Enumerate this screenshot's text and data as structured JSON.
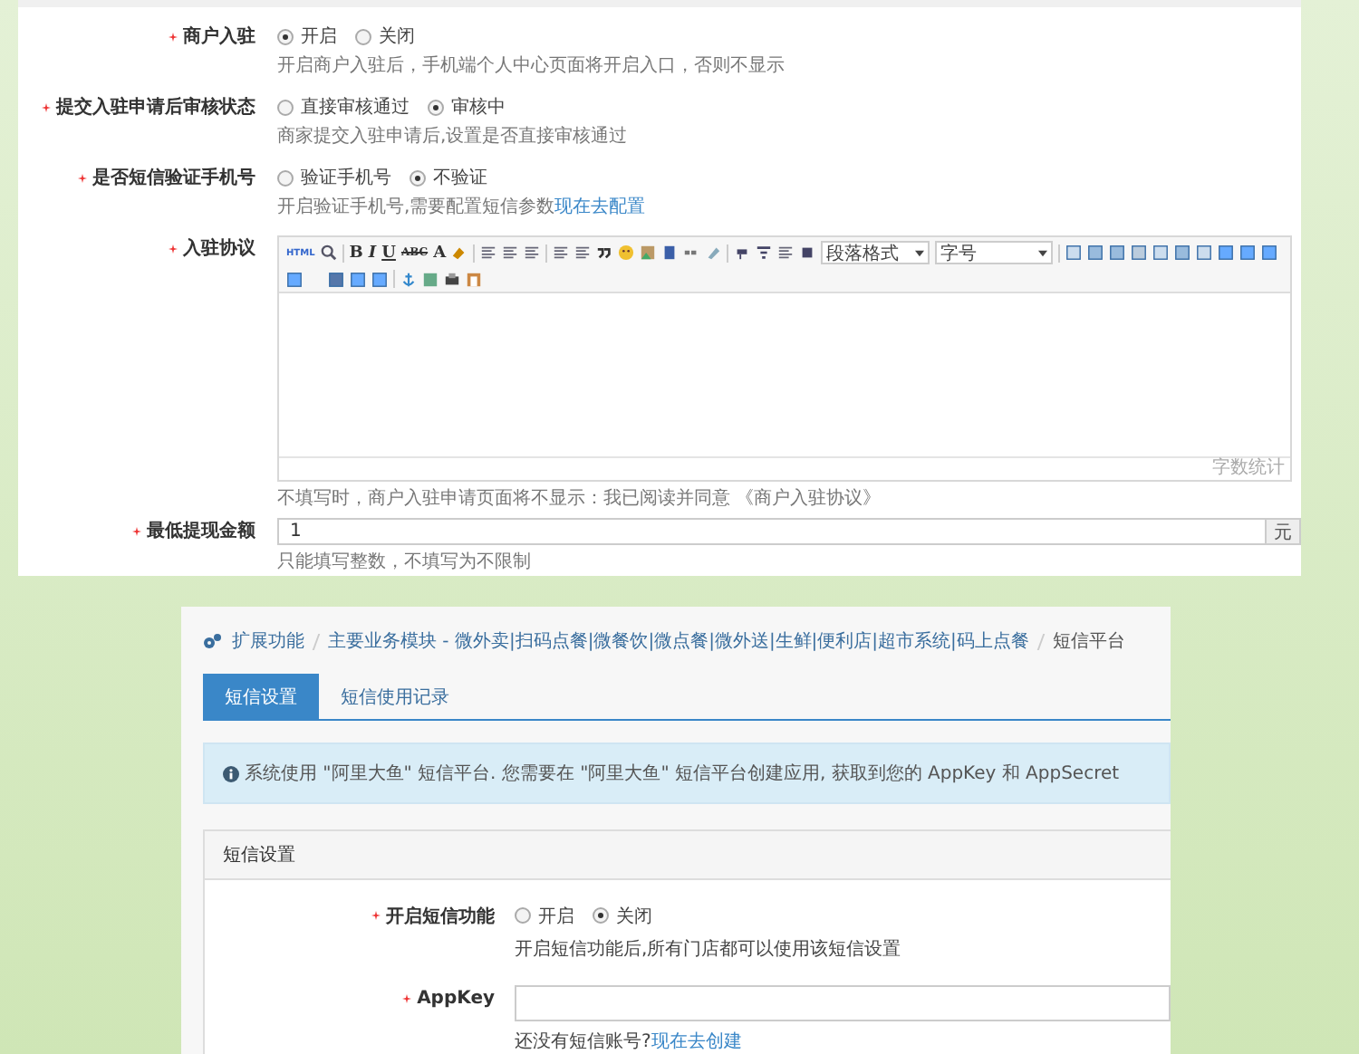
{
  "top_form": {
    "rows": [
      {
        "kind": "radio",
        "label": "商户入驻",
        "required": true,
        "options": [
          {
            "label": "开启",
            "selected": true
          },
          {
            "label": "关闭",
            "selected": false
          }
        ],
        "hint": "开启商户入驻后，手机端个人中心页面将开启入口，否则不显示"
      },
      {
        "kind": "radio",
        "label": "提交入驻申请后审核状态",
        "required": true,
        "options": [
          {
            "label": "直接审核通过",
            "selected": false
          },
          {
            "label": "审核中",
            "selected": true
          }
        ],
        "hint": "商家提交入驻申请后,设置是否直接审核通过"
      },
      {
        "kind": "radio",
        "label": "是否短信验证手机号",
        "required": true,
        "options": [
          {
            "label": "验证手机号",
            "selected": false
          },
          {
            "label": "不验证",
            "selected": true
          }
        ],
        "hint": "开启验证手机号,需要配置短信参数",
        "hint_link": "现在去配置"
      },
      {
        "kind": "editor",
        "label": "入驻协议",
        "required": true,
        "toolbar": {
          "html_label": "HTML",
          "text_buttons": [
            "B",
            "I",
            "U",
            "ABC",
            "A"
          ],
          "selects": [
            "段落格式",
            "字号"
          ]
        },
        "word_count": "字数统计",
        "hint": "不填写时，商户入驻申请页面将不显示：我已阅读并同意 《商户入驻协议》"
      },
      {
        "kind": "input",
        "label": "最低提现金额",
        "required": true,
        "value": "1",
        "addon": "元",
        "hint": "只能填写整数，不填写为不限制"
      }
    ]
  },
  "sms_page": {
    "breadcrumb": [
      {
        "label": "扩展功能",
        "current": false
      },
      {
        "label": "主要业务模块 - 微外卖|扫码点餐|微餐饮|微点餐|微外送|生鲜|便利店|超市系统|码上点餐",
        "current": false
      },
      {
        "label": "短信平台",
        "current": true
      }
    ],
    "tabs": [
      {
        "label": "短信设置",
        "selected": true
      },
      {
        "label": "短信使用记录",
        "selected": false
      }
    ],
    "alert": "系统使用 \"阿里大鱼\" 短信平台. 您需要在 \"阿里大鱼\" 短信平台创建应用, 获取到您的 AppKey 和 AppSecret",
    "panel": {
      "title": "短信设置",
      "rows": [
        {
          "kind": "radio",
          "label": "开启短信功能",
          "required": true,
          "options": [
            {
              "label": "开启",
              "selected": false
            },
            {
              "label": "关闭",
              "selected": true
            }
          ],
          "hint": "开启短信功能后,所有门店都可以使用该短信设置"
        },
        {
          "kind": "input",
          "label": "AppKey",
          "required": true,
          "hint": "还没有短信账号?",
          "hint_link": "现在去创建"
        }
      ]
    }
  }
}
